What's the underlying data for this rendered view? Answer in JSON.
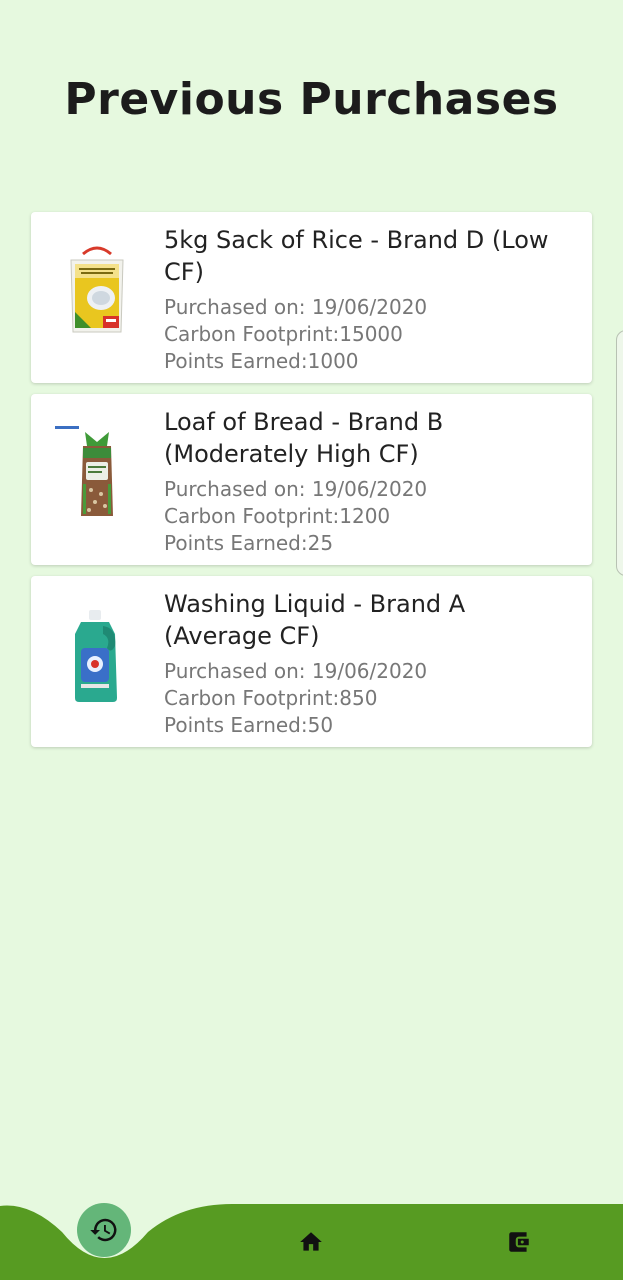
{
  "header": {
    "title": "Previous Purchases"
  },
  "purchases": [
    {
      "title": "5kg Sack of Rice - Brand D (Low CF)",
      "purchased_on": "Purchased on: 19/06/2020",
      "carbon_footprint": "Carbon Footprint:15000",
      "points_earned": "Points Earned:1000",
      "image": "rice-sack-image"
    },
    {
      "title": "Loaf of Bread - Brand B (Moderately High CF)",
      "purchased_on": "Purchased on: 19/06/2020",
      "carbon_footprint": "Carbon Footprint:1200",
      "points_earned": "Points Earned:25",
      "image": "bread-loaf-image"
    },
    {
      "title": "Washing Liquid - Brand A (Average CF)",
      "purchased_on": "Purchased on: 19/06/2020",
      "carbon_footprint": "Carbon Footprint:850",
      "points_earned": "Points Earned:50",
      "image": "washing-liquid-image"
    }
  ],
  "bottom_nav": {
    "items": [
      {
        "icon": "history-icon",
        "active": true
      },
      {
        "icon": "home-icon",
        "active": false
      },
      {
        "icon": "wallet-icon",
        "active": false
      }
    ]
  },
  "colors": {
    "background": "#e6f9df",
    "nav_bar": "#579b22",
    "active_button": "#64b679",
    "title_text": "#1c1c1c",
    "secondary_text": "#777777"
  }
}
